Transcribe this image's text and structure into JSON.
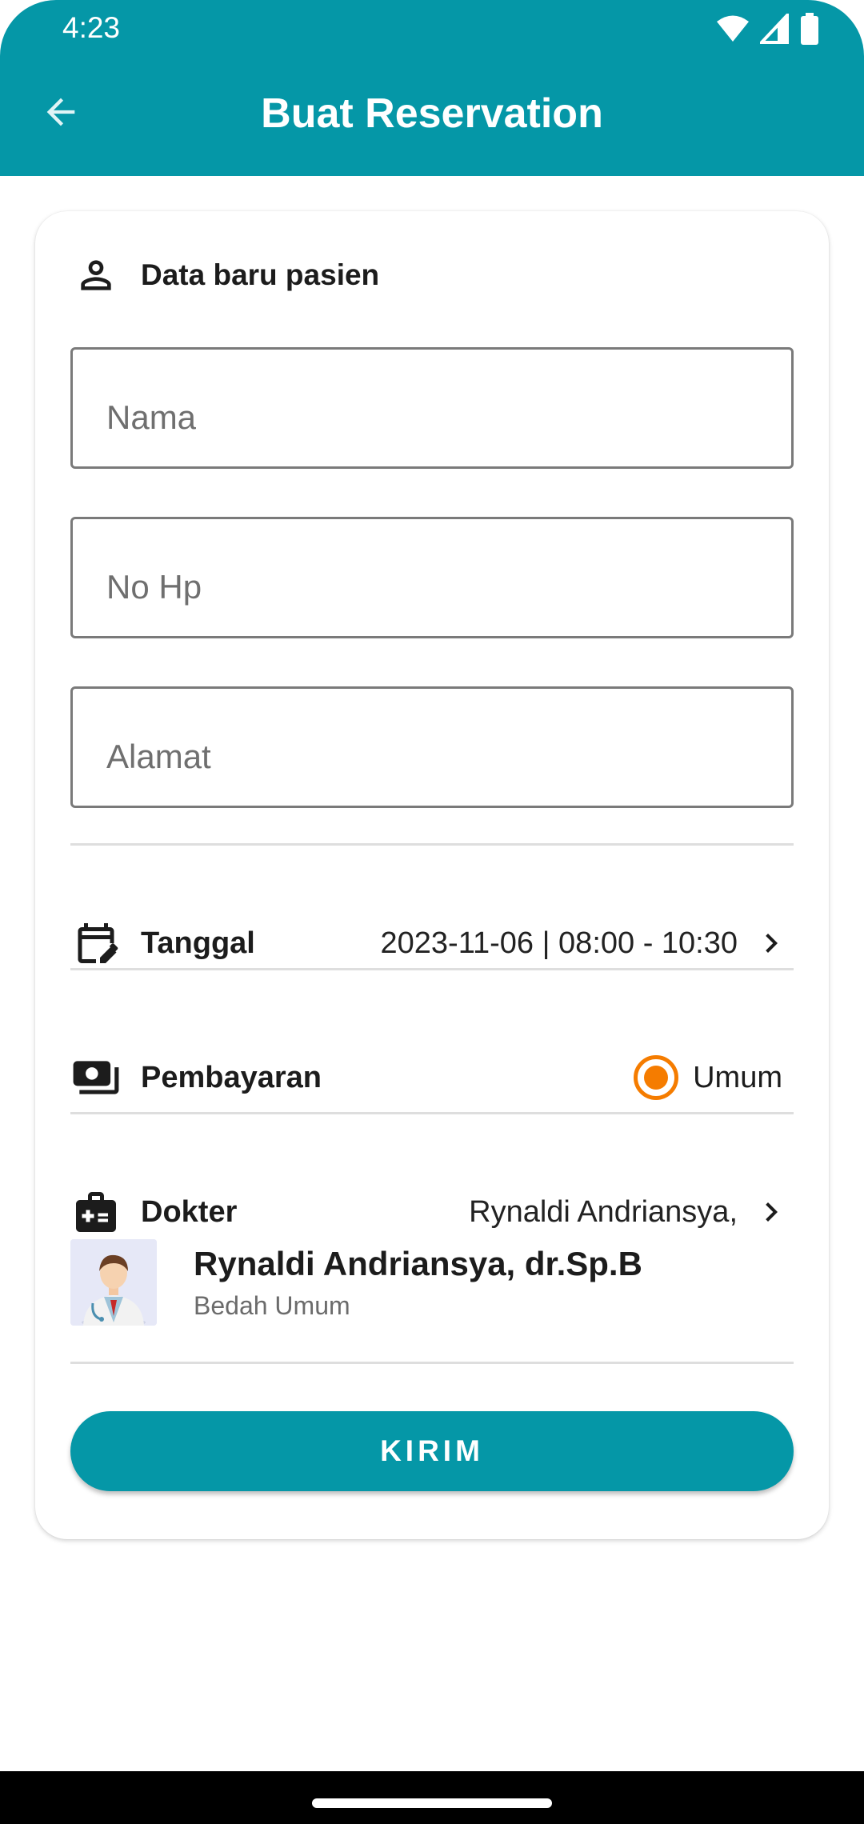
{
  "status_bar": {
    "time": "4:23"
  },
  "app_bar": {
    "title": "Buat Reservation"
  },
  "form": {
    "section_title": "Data baru pasien",
    "name_placeholder": "Nama",
    "phone_placeholder": "No Hp",
    "address_placeholder": "Alamat"
  },
  "date_row": {
    "label": "Tanggal",
    "value": "2023-11-06 | 08:00 - 10:30"
  },
  "payment_row": {
    "label": "Pembayaran",
    "option": "Umum",
    "selected": true
  },
  "doctor_row": {
    "label": "Dokter",
    "value": "Rynaldi Andriansya,"
  },
  "doctor_card": {
    "name": "Rynaldi Andriansya, dr.Sp.B",
    "specialty": "Bedah Umum"
  },
  "submit_label": "KIRIM",
  "colors": {
    "primary": "#0597a7",
    "accent": "#f57c00"
  },
  "icons": [
    "back-arrow-icon",
    "wifi-icon",
    "signal-icon",
    "battery-icon",
    "person-icon",
    "calendar-edit-icon",
    "payment-icon",
    "medical-bag-icon",
    "chevron-right-icon"
  ]
}
